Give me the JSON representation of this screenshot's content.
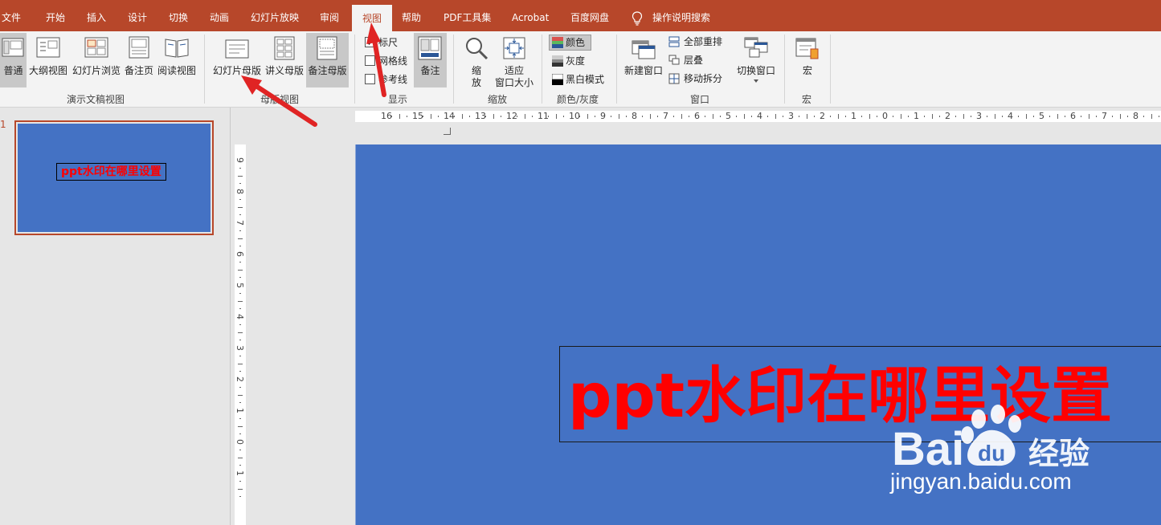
{
  "tabs": [
    "文件",
    "开始",
    "插入",
    "设计",
    "切换",
    "动画",
    "幻灯片放映",
    "审阅",
    "视图",
    "帮助",
    "PDF工具集",
    "Acrobat",
    "百度网盘"
  ],
  "active_tab": "视图",
  "tell_me": "操作说明搜索",
  "ribbon": {
    "presentation_views": {
      "label": "演示文稿视图",
      "items": [
        "普通",
        "大纲视图",
        "幻灯片浏览",
        "备注页",
        "阅读视图"
      ]
    },
    "master_views": {
      "label": "母版视图",
      "items": [
        "幻灯片母版",
        "讲义母版",
        "备注母版"
      ]
    },
    "show": {
      "label": "显示",
      "ruler": "标尺",
      "gridlines": "网格线",
      "guides": "参考线",
      "notes": "备注"
    },
    "zoom": {
      "label": "缩放",
      "zoom_line1": "缩",
      "zoom_line2": "放",
      "fit_line1": "适应",
      "fit_line2": "窗口大小"
    },
    "color": {
      "label": "颜色/灰度",
      "color": "颜色",
      "grayscale": "灰度",
      "bw": "黑白模式"
    },
    "window": {
      "label": "窗口",
      "new_window": "新建窗口",
      "arrange_all": "全部重排",
      "cascade": "层叠",
      "move_split": "移动拆分",
      "switch_windows": "切换窗口"
    },
    "macros": {
      "label": "宏",
      "macros": "宏"
    }
  },
  "thumbnail": {
    "number": "1",
    "text": "ppt水印在哪里设置"
  },
  "slide": {
    "text": "ppt水印在哪里设置"
  },
  "hruler_labels": [
    "16",
    "15",
    "14",
    "13",
    "12",
    "11",
    "10",
    "9",
    "8",
    "7",
    "6",
    "5",
    "4",
    "3",
    "2",
    "1",
    "0",
    "1",
    "2",
    "3",
    "4",
    "5",
    "6",
    "7",
    "8"
  ],
  "vruler_labels": [
    "9",
    "8",
    "7",
    "6",
    "5",
    "4",
    "3",
    "2",
    "1",
    "0",
    "1"
  ],
  "watermark": {
    "brand_bai": "Bai",
    "brand_du": "du",
    "brand_cn": "经验",
    "url": "jingyan.baidu.com"
  },
  "colors": {
    "accent": "#b7472a",
    "slide_bg": "#4472c4",
    "text_red": "#ff0000"
  }
}
